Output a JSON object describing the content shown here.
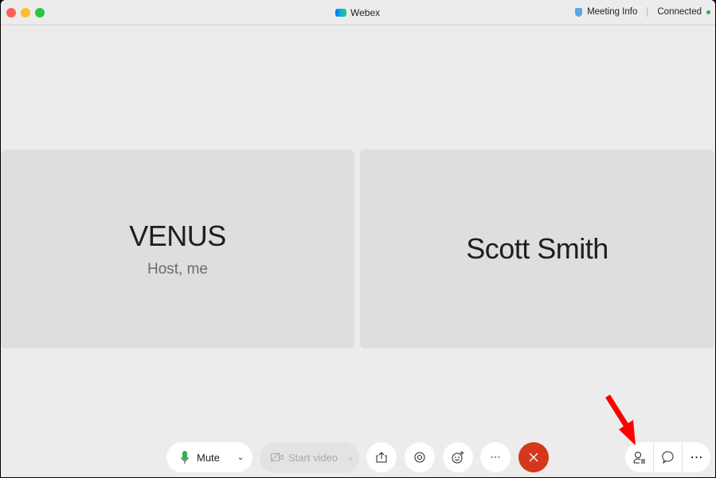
{
  "window": {
    "title": "Webex",
    "meeting_info": "Meeting Info",
    "status": "Connected",
    "status_color": "#1db954"
  },
  "participants": [
    {
      "name": "VENUS",
      "role": "Host, me"
    },
    {
      "name": "Scott Smith"
    }
  ],
  "toolbar": {
    "mute": "Mute",
    "start_video": "Start video",
    "end_color": "#d4371c"
  },
  "annotation": {
    "arrow_color": "#ff0000",
    "arrow_target": "participants-button"
  }
}
